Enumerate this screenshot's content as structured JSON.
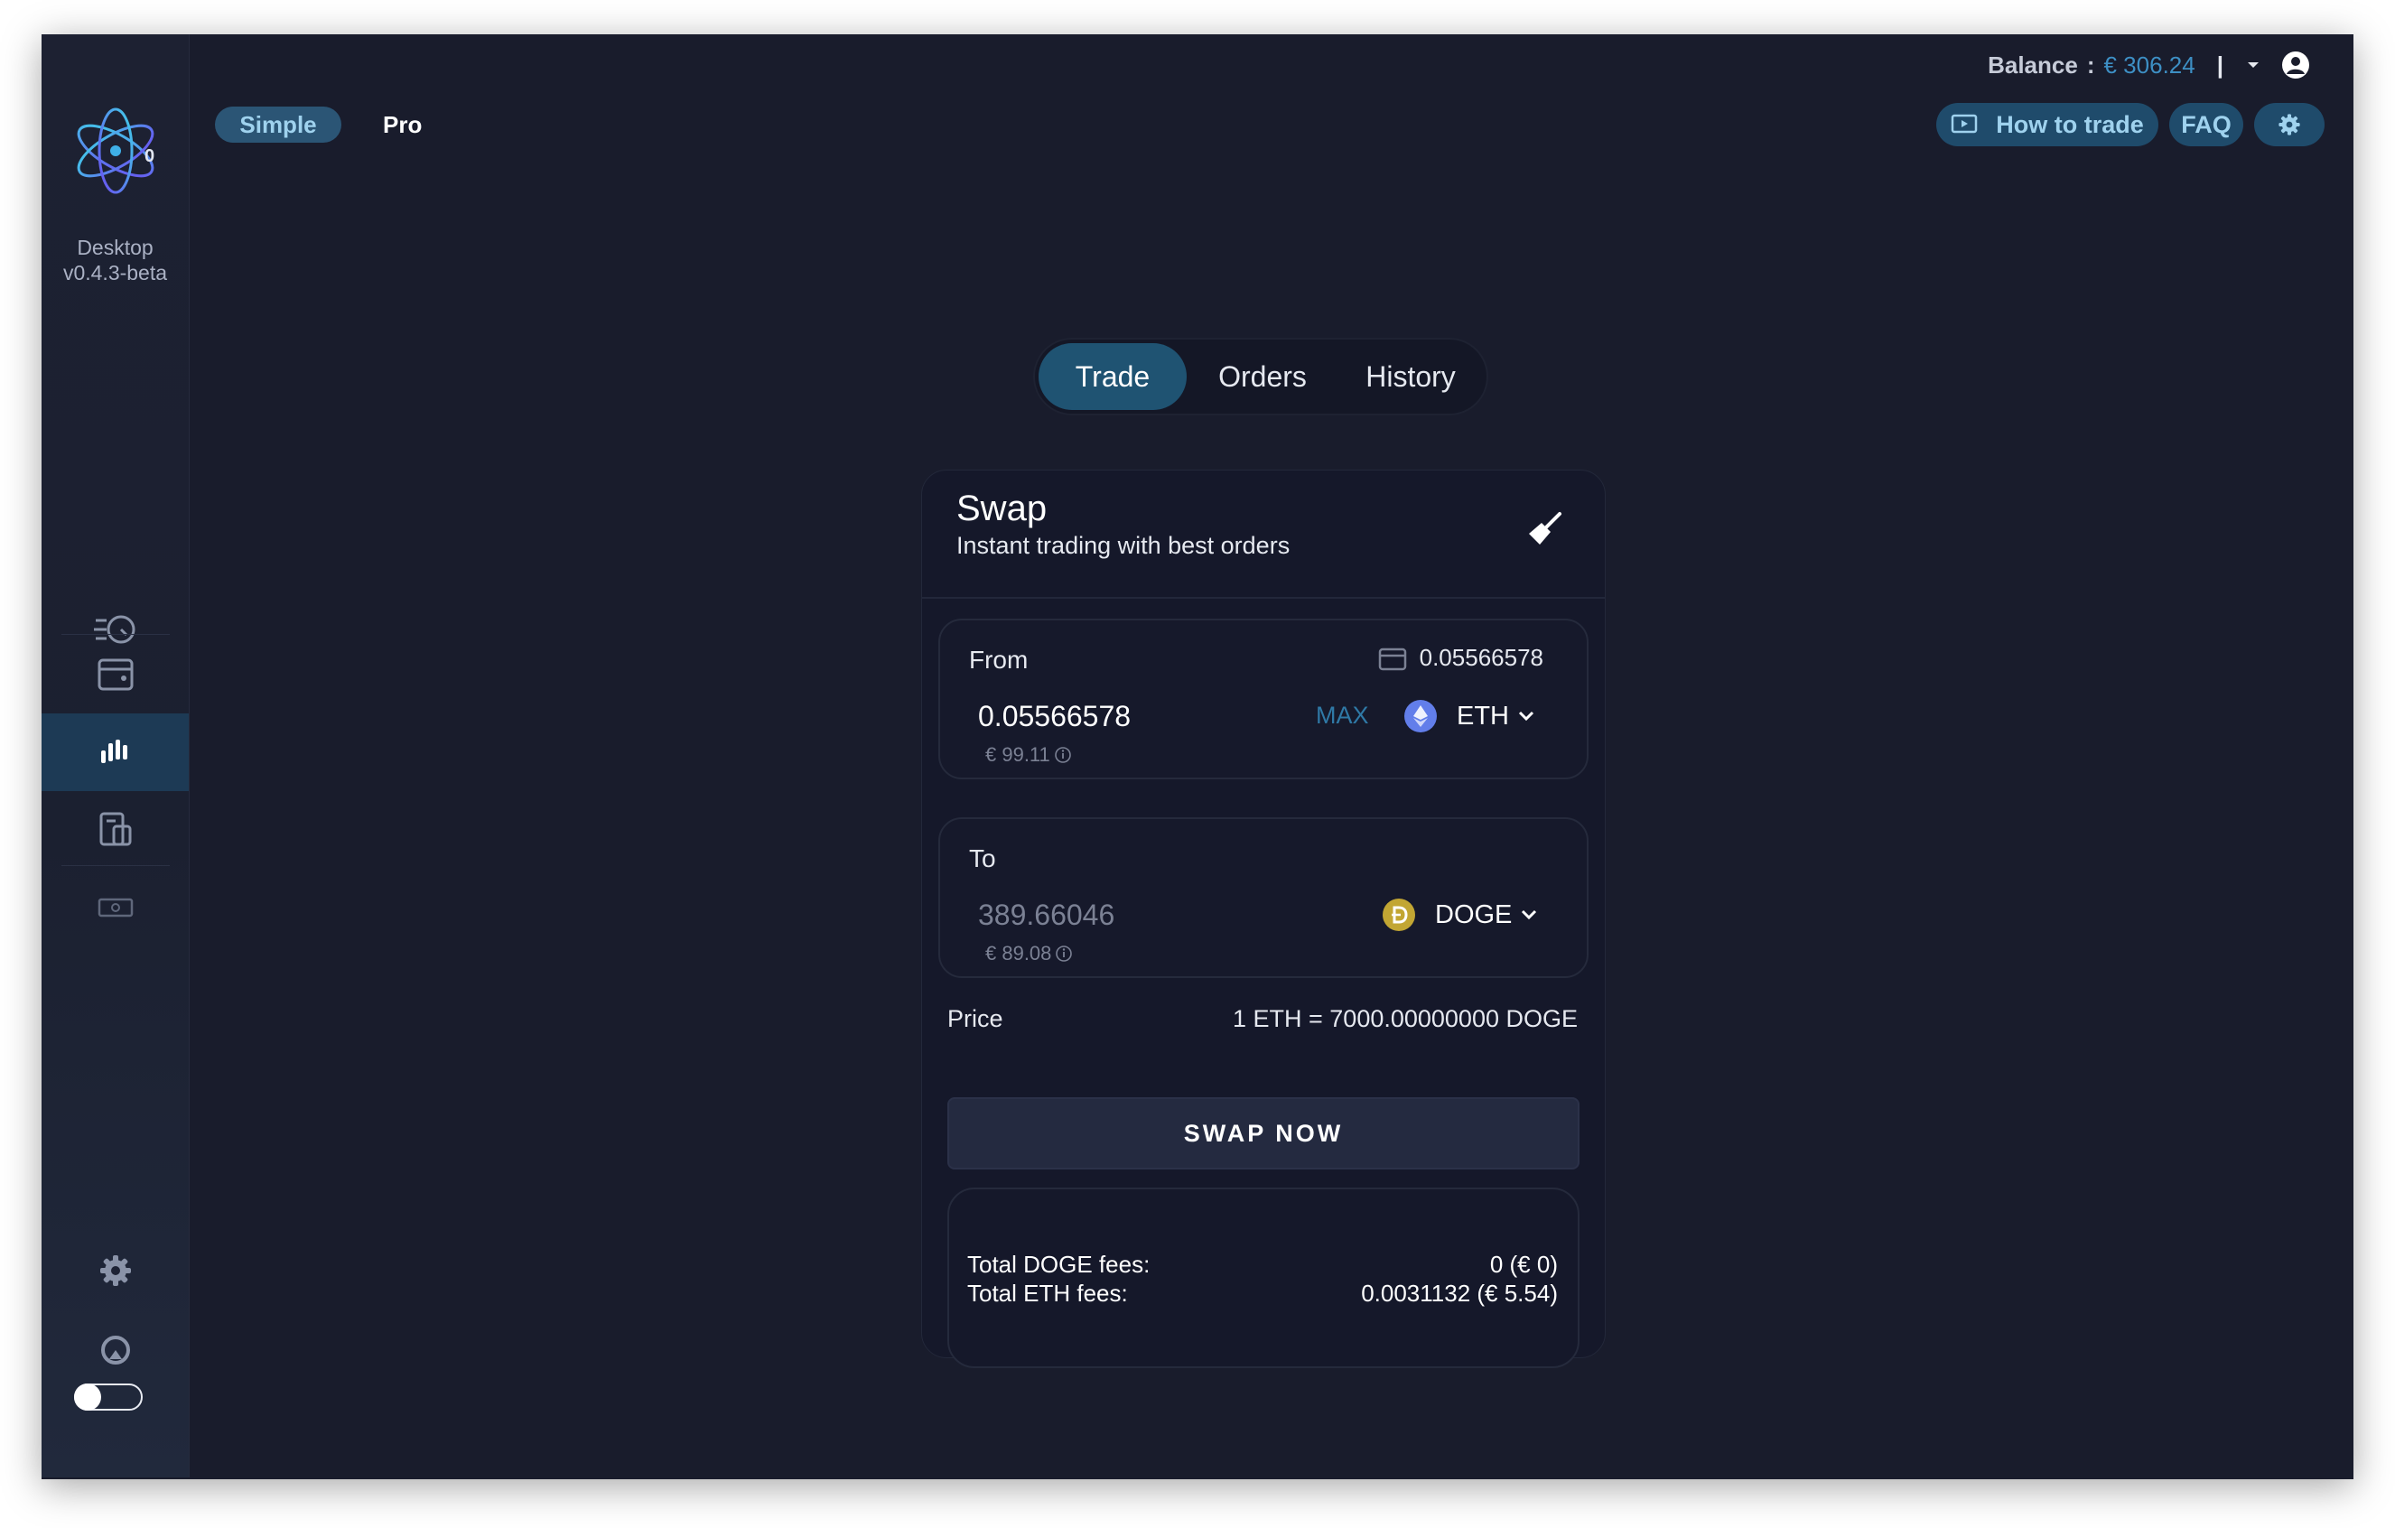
{
  "app": {
    "version_line1": "Desktop",
    "version_line2": "v0.4.3-beta",
    "logo_badge": "0"
  },
  "header": {
    "modes": {
      "simple": "Simple",
      "pro": "Pro"
    },
    "balance_label": "Balance",
    "balance_colon": ":",
    "balance_value": "€ 306.24",
    "separator": "|",
    "how_to_trade": "How to trade",
    "faq": "FAQ"
  },
  "tabs": [
    {
      "label": "Trade",
      "active": true
    },
    {
      "label": "Orders",
      "active": false
    },
    {
      "label": "History",
      "active": false
    }
  ],
  "swap": {
    "title": "Swap",
    "subtitle": "Instant trading with best orders",
    "from": {
      "label": "From",
      "wallet_balance": "0.05566578",
      "amount": "0.05566578",
      "fiat": "€ 99.11",
      "max_label": "MAX",
      "coin": "ETH"
    },
    "to": {
      "label": "To",
      "amount": "389.66046",
      "fiat": "€ 89.08",
      "coin": "DOGE"
    },
    "price_label": "Price",
    "price_value": "1 ETH = 7000.00000000 DOGE",
    "swap_button": "SWAP NOW",
    "fees": [
      {
        "label": "Total DOGE fees:",
        "value": "0 (€ 0)"
      },
      {
        "label": "Total ETH fees:",
        "value": "0.0031132 (€ 5.54)"
      }
    ]
  },
  "colors": {
    "background": "#191c2c",
    "accent": "#1f5372",
    "accent_text": "#9fd2ee",
    "balance_value": "#3d8fc4",
    "eth": "#627eea",
    "doge": "#c2a633"
  },
  "icons": {
    "clear": "broom-icon",
    "wallet": "wallet-icon",
    "eth": "ethereum-icon",
    "doge": "dogecoin-icon",
    "user": "user-icon",
    "settings": "gear-icon"
  }
}
